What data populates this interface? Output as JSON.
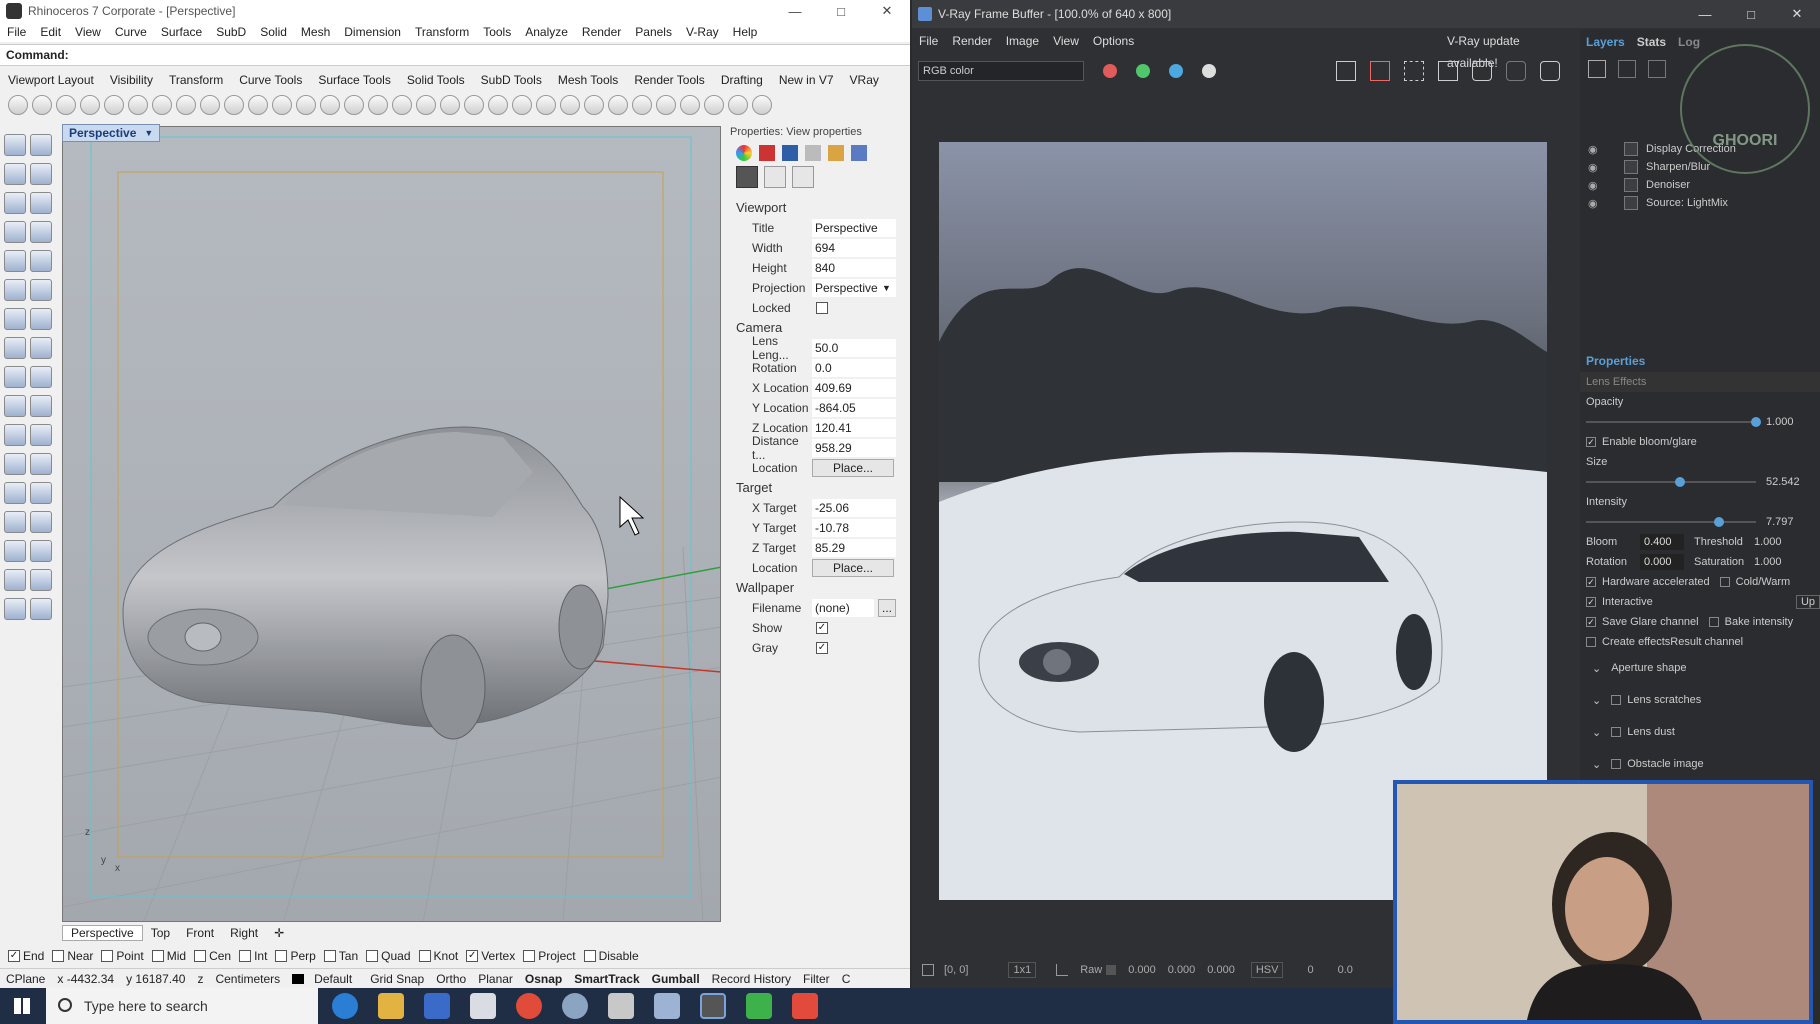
{
  "rhino": {
    "title": "Rhinoceros 7 Corporate - [Perspective]",
    "menu": [
      "File",
      "Edit",
      "View",
      "Curve",
      "Surface",
      "SubD",
      "Solid",
      "Mesh",
      "Dimension",
      "Transform",
      "Tools",
      "Analyze",
      "Render",
      "Panels",
      "V-Ray",
      "Help"
    ],
    "command_label": "Command:",
    "toolbar_tabs": [
      "Viewport Layout",
      "Visibility",
      "Transform",
      "Curve Tools",
      "Surface Tools",
      "Solid Tools",
      "SubD Tools",
      "Mesh Tools",
      "Render Tools",
      "Drafting",
      "New in V7",
      "VRay"
    ],
    "viewport_label": "Perspective",
    "viewport_tabs": [
      "Perspective",
      "Top",
      "Front",
      "Right"
    ],
    "axis_labels": {
      "z": "z",
      "y": "y",
      "x": "x"
    },
    "properties": {
      "header": "Properties: View properties",
      "viewport_section": "Viewport",
      "viewport": [
        {
          "k": "Title",
          "v": "Perspective"
        },
        {
          "k": "Width",
          "v": "694"
        },
        {
          "k": "Height",
          "v": "840"
        },
        {
          "k": "Projection",
          "v": "Perspective"
        }
      ],
      "locked_label": "Locked",
      "camera_section": "Camera",
      "camera": [
        {
          "k": "Lens Leng...",
          "v": "50.0"
        },
        {
          "k": "Rotation",
          "v": "0.0"
        },
        {
          "k": "X Location",
          "v": "409.69"
        },
        {
          "k": "Y Location",
          "v": "-864.05"
        },
        {
          "k": "Z Location",
          "v": "120.41"
        },
        {
          "k": "Distance t...",
          "v": "958.29"
        }
      ],
      "camera_location_label": "Location",
      "place_button": "Place...",
      "target_section": "Target",
      "target": [
        {
          "k": "X Target",
          "v": "-25.06"
        },
        {
          "k": "Y Target",
          "v": "-10.78"
        },
        {
          "k": "Z Target",
          "v": "85.29"
        }
      ],
      "target_location_label": "Location",
      "wallpaper_section": "Wallpaper",
      "filename_label": "Filename",
      "filename_value": "(none)",
      "browse_button": "...",
      "show_label": "Show",
      "gray_label": "Gray"
    },
    "osnaps": [
      {
        "label": "End",
        "checked": true
      },
      {
        "label": "Near",
        "checked": false
      },
      {
        "label": "Point",
        "checked": false
      },
      {
        "label": "Mid",
        "checked": false
      },
      {
        "label": "Cen",
        "checked": false
      },
      {
        "label": "Int",
        "checked": false
      },
      {
        "label": "Perp",
        "checked": false
      },
      {
        "label": "Tan",
        "checked": false
      },
      {
        "label": "Quad",
        "checked": false
      },
      {
        "label": "Knot",
        "checked": false
      },
      {
        "label": "Vertex",
        "checked": true
      },
      {
        "label": "Project",
        "checked": false
      },
      {
        "label": "Disable",
        "checked": false
      }
    ],
    "status": {
      "cplane": "CPlane",
      "x": "x -4432.34",
      "y": "y 16187.40",
      "z": "z",
      "units": "Centimeters",
      "layer": "Default",
      "items": [
        "Grid Snap",
        "Ortho",
        "Planar",
        "Osnap",
        "SmartTrack",
        "Gumball",
        "Record History",
        "Filter",
        "C"
      ]
    }
  },
  "vray": {
    "title": "V-Ray Frame Buffer - [100.0% of 640 x 800]",
    "menu": [
      "File",
      "Render",
      "Image",
      "View",
      "Options"
    ],
    "update": "V-Ray update available!",
    "channel": "RGB color",
    "colors": {
      "red": "#e25b5b",
      "green": "#4fc76a",
      "blue": "#4ea8e0"
    },
    "side_tabs": [
      "Layers",
      "Stats",
      "Log"
    ],
    "layers": [
      "Display Correction",
      "Sharpen/Blur",
      "Denoiser",
      "Source: LightMix"
    ],
    "watermark": "GHOORI",
    "properties_tab": "Properties",
    "lens_effects": "Lens Effects",
    "opacity_label": "Opacity",
    "opacity": "1.000",
    "opacity_pct": 1.0,
    "bloom_label": "Enable bloom/glare",
    "size_label": "Size",
    "size": "52.542",
    "size_pct": 0.55,
    "intensity_label": "Intensity",
    "intensity": "7.797",
    "intensity_pct": 0.78,
    "bloom_name": "Bloom",
    "bloom": "0.400",
    "threshold_label": "Threshold",
    "threshold": "1.000",
    "rotation_label": "Rotation",
    "rotation": "0.000",
    "saturation_label": "Saturation",
    "saturation": "1.000",
    "hw_label": "Hardware accelerated",
    "coldwarm_label": "Cold/Warm",
    "interactive_label": "Interactive",
    "update_btn": "Up",
    "saveglare_label": "Save Glare channel",
    "bake_label": "Bake intensity",
    "effects_label": "Create effectsResult channel",
    "aperture": "Aperture shape",
    "scratches": "Lens scratches",
    "dust": "Lens dust",
    "obstacle": "Obstacle image",
    "bottom": {
      "coords": "[0, 0]",
      "zoom": "1x1",
      "raw": "Raw",
      "r": "0.000",
      "g": "0.000",
      "b": "0.000",
      "mode": "HSV",
      "v1": "0",
      "v2": "0.0"
    }
  },
  "taskbar": {
    "search_placeholder": "Type here to search"
  }
}
